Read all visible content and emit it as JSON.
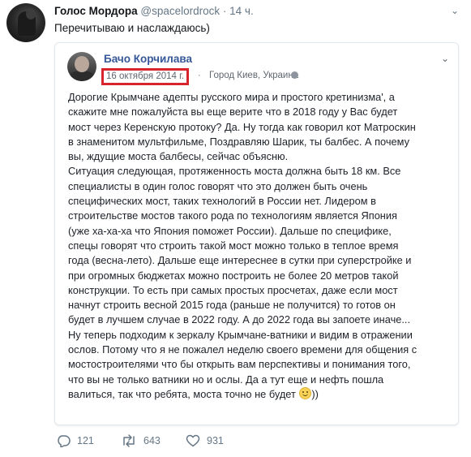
{
  "tweet": {
    "author_name": "Голос Мордора",
    "author_handle": "@spacelordrock",
    "separator": "·",
    "time": "14 ч.",
    "text": "Перечитываю и наслаждаюсь)"
  },
  "fb_post": {
    "author": "Бачо Корчилава",
    "date": "16 октября 2014 г.",
    "separator": "·",
    "location": "Город Киев, Украина",
    "lines": [
      "Дорогие Крымчане адепты русского мира и простого кретинизма', а",
      "скажите мне пожалуйста вы еще верите что в 2018 году у Вас будет",
      "мост через Керенскую протоку? Да. Ну тогда как говорил кот Матроскин",
      "в знаменитом мультфильме, Поздравляю Шарик, ты балбес. А почему",
      "вы, ждущие моста балбесы, сейчас объясню.",
      "Ситуация следующая, протяженность моста должна быть 18 км. Все",
      "специалисты в один голос говорят что это должен быть очень",
      "специфических мост, таких технологий в России нет. Лидером в",
      "строительстве мостов такого рода по технологиям является Япония",
      "(уже ха-ха-ха что Япония поможет России). Дальше по специфике,",
      "спецы говорят что строить такой мост можно только в теплое время",
      "года (весна-лето). Дальше еще интереснее в сутки при суперстройке и",
      "при огромных бюджетах можно построить не более 20 метров такой",
      "конструкции. То есть при самых простых просчетах, даже если мост",
      "начнут строить весной 2015 года (раньше не получится) то готов он",
      "будет в лучшем случае в 2022 году. А до 2022 года вы запоете иначе...",
      "Ну теперь подходим к зеркалу Крымчане-ватники и видим в отражении",
      "ослов. Потому что я не пожалел неделю своего времени для общения с",
      "мостостроителями что бы открыть вам перспективы и понимания того,",
      "что вы не только ватники но и ослы. Да а тут еще и нефть пошла"
    ],
    "last_line": "валиться, так что ребята, моста точно не будет",
    "last_line_end": "))"
  },
  "actions": {
    "replies": "121",
    "retweets": "643",
    "likes": "931"
  },
  "colors": {
    "link_blue": "#365899",
    "highlight_red": "#d8252d",
    "muted_gray": "#657786"
  },
  "icons": [
    "reply-icon",
    "retweet-icon",
    "like-icon",
    "smile-emoji-icon",
    "globe-icon",
    "chevron-down-icon"
  ]
}
